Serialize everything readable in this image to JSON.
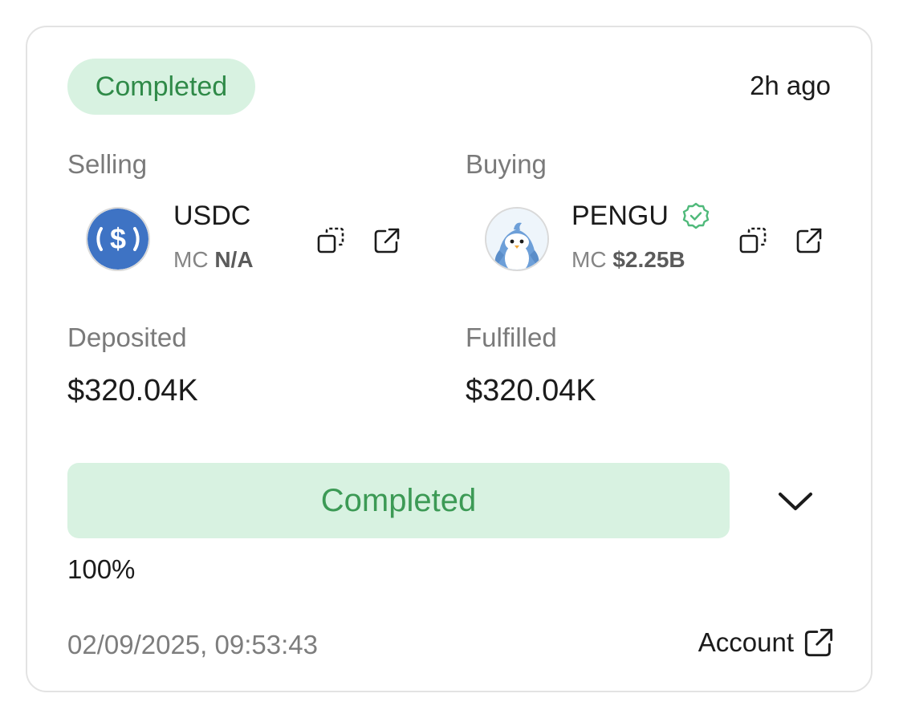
{
  "status": {
    "label": "Completed",
    "time_ago": "2h ago"
  },
  "selling": {
    "label": "Selling",
    "symbol": "USDC",
    "mc_prefix": "MC",
    "mc_value": "N/A",
    "logo_icon": "usdc-logo-icon",
    "logo_color": "#3e73c4"
  },
  "buying": {
    "label": "Buying",
    "symbol": "PENGU",
    "mc_prefix": "MC",
    "mc_value": "$2.25B",
    "logo_icon": "pengu-logo-icon",
    "verified_icon": "verified-badge-icon"
  },
  "deposited": {
    "label": "Deposited",
    "value": "$320.04K"
  },
  "fulfilled": {
    "label": "Fulfilled",
    "value": "$320.04K"
  },
  "progress": {
    "label": "Completed",
    "percent_text": "100%",
    "fraction": 1.0
  },
  "footer": {
    "timestamp": "02/09/2025, 09:53:43",
    "account_label": "Account"
  },
  "colors": {
    "success_bg": "#d8f2e1",
    "success_text": "#3c9a55",
    "verified": "#4fb97a"
  }
}
